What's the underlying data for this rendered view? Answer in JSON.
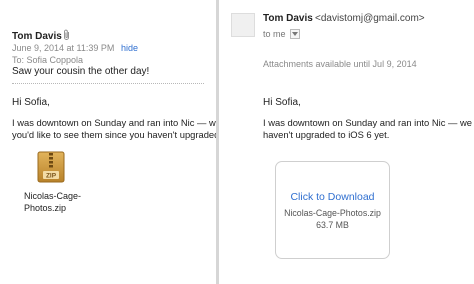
{
  "left_message": {
    "sender": "Tom Davis",
    "date": "June 9, 2014 at 11:39 PM",
    "hide_link": "hide",
    "to": "To:  Sofia Coppola",
    "subject": "Saw your cousin the other day!",
    "greeting": "Hi Sofia,",
    "body_lines": [
      "I was downtown on Sunday and ran into Nic — we",
      "you'd like to see them since you haven't upgraded"
    ],
    "attachment": {
      "icon": "zip-file-icon",
      "icon_text": "ZIP",
      "filename_lines": [
        "Nicolas-Cage-",
        "Photos.zip"
      ]
    }
  },
  "right_message": {
    "sender": "Tom Davis",
    "sender_email": "<davistomj@gmail.com>",
    "recipient": "to me",
    "attachments_notice": "Attachments available until Jul 9, 2014",
    "greeting": "Hi Sofia,",
    "body_lines": [
      "I was downtown on Sunday and ran into Nic — we",
      "haven't upgraded to iOS 6 yet."
    ],
    "download": {
      "link_label": "Click to Download",
      "filename": "Nicolas-Cage-Photos.zip",
      "size": "63.7 MB"
    }
  },
  "colors": {
    "link": "#2f6fd0",
    "muted": "#8a8a8a",
    "separator": "#d6d6d6"
  }
}
